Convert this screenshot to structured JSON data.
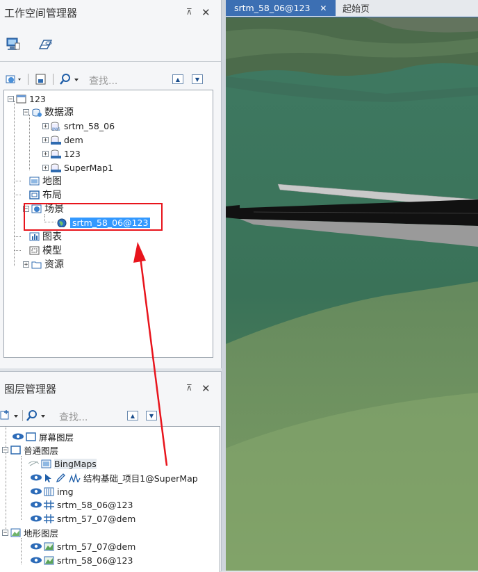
{
  "workspace_panel": {
    "title": "工作空间管理器",
    "pin": "⊼",
    "close": "✕",
    "search_placeholder": "查找...",
    "tree": {
      "root": "123",
      "datasource_group": "数据源",
      "datasources": [
        "srtm_58_06",
        "dem",
        "123",
        "SuperMap1"
      ],
      "map": "地图",
      "layout": "布局",
      "scene": "场景",
      "scene_item": "srtm_58_06@123",
      "chart": "图表",
      "model": "模型",
      "resource": "资源"
    }
  },
  "layer_panel": {
    "title": "图层管理器",
    "pin": "⊼",
    "close": "✕",
    "search_placeholder": "查找...",
    "tree": {
      "screen_layer": "屏幕图层",
      "normal_layer": "普通图层",
      "bingmaps": "BingMaps",
      "structure": "结构基础_项目1@SuperMap",
      "img": "img",
      "srtm5806": "srtm_58_06@123",
      "srtm5707": "srtm_57_07@dem",
      "terrain_layer": "地形图层",
      "terrain_srtm5707": "srtm_57_07@dem",
      "terrain_srtm5806": "srtm_58_06@123"
    }
  },
  "tabs": [
    {
      "label": "srtm_58_06@123",
      "active": true,
      "close": "✕"
    },
    {
      "label": "起始页",
      "active": false
    }
  ],
  "colors": {
    "annotation_red": "#e8141c",
    "selection_blue": "#3399ff",
    "active_tab": "#3c6fb3"
  }
}
